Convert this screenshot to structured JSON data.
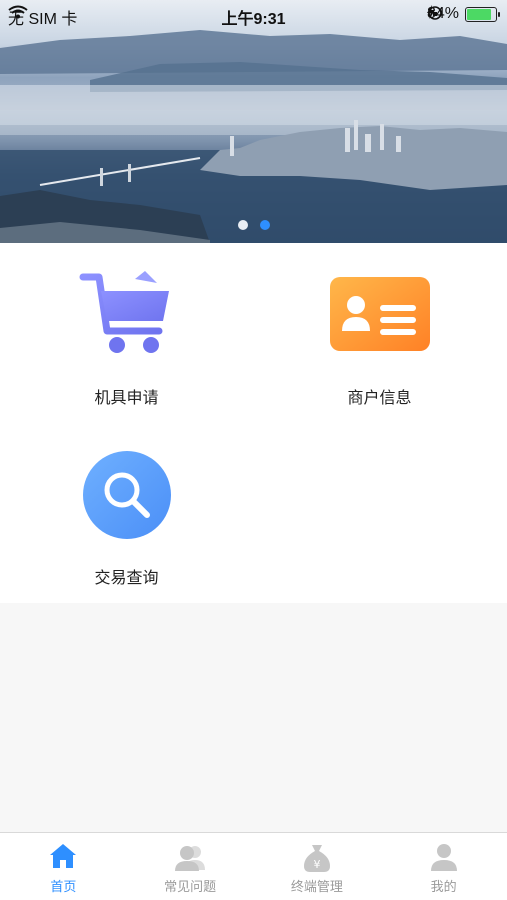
{
  "status_bar": {
    "carrier": "无 SIM 卡",
    "time": "上午9:31",
    "battery_percent": "84%",
    "battery_level": 0.84
  },
  "banner": {
    "slide_count": 2,
    "active_slide": 2
  },
  "menu": [
    {
      "label": "机具申请",
      "icon": "shopping-cart-icon"
    },
    {
      "label": "商户信息",
      "icon": "id-card-icon"
    },
    {
      "label": "交易查询",
      "icon": "search-icon"
    }
  ],
  "tabbar": {
    "tabs": [
      {
        "label": "首页",
        "icon": "home-icon",
        "active": true
      },
      {
        "label": "常见问题",
        "icon": "users-icon",
        "active": false
      },
      {
        "label": "终端管理",
        "icon": "money-bag-icon",
        "active": false
      },
      {
        "label": "我的",
        "icon": "user-icon",
        "active": false
      }
    ]
  },
  "colors": {
    "accent": "#2e8fff",
    "inactive": "#9a9a9a",
    "cart_purple": "#7b7ff5",
    "card_orange": "#ff8c2e",
    "search_blue": "#5b9dff"
  }
}
